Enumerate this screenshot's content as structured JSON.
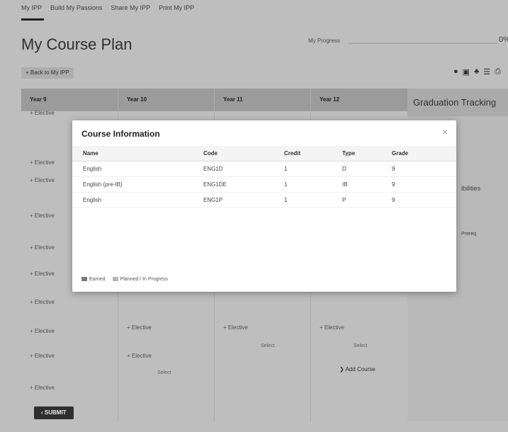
{
  "topnav": {
    "items": [
      "My IPP",
      "Build My Passions",
      "Share My IPP",
      "Print My IPP"
    ]
  },
  "page": {
    "title": "My Course Plan"
  },
  "progress": {
    "label": "My Progress",
    "percent": "0%"
  },
  "back_button": {
    "label": "Back to My IPP",
    "icon": "plus-icon"
  },
  "toolbar": {
    "icons": [
      "help-icon",
      "document-icon",
      "share-icon",
      "list-icon",
      "print-icon"
    ]
  },
  "years": [
    {
      "label": "Year 9"
    },
    {
      "label": "Year 10"
    },
    {
      "label": "Year 11"
    },
    {
      "label": "Year 12"
    }
  ],
  "year9_slots": [
    "+ Elective",
    "+ Elective",
    "+ Elective",
    "+ Elective",
    "+ Elective",
    "+ Elective",
    "+ Elective"
  ],
  "bottom_slots": {
    "y9": [
      "+ Elective",
      "+ Elective",
      "+ Elective"
    ],
    "y10": [
      "+ Elective",
      "+ Elective"
    ],
    "y11": [
      "+ Elective"
    ],
    "y12": [
      "+ Elective"
    ]
  },
  "course_selects": {
    "y10": "Select",
    "y11": "Select",
    "y12": "Select"
  },
  "add_course": {
    "label": "Add Course"
  },
  "graduation": {
    "title": "Graduation Tracking",
    "frag1": "ibilities",
    "frag2": "Prereq"
  },
  "submit": {
    "label": "SUBMIT"
  },
  "modal": {
    "title": "Course Information",
    "close": "×",
    "headers": {
      "name": "Name",
      "code": "Code",
      "credit": "Credit",
      "type": "Type",
      "grade": "Grade"
    },
    "rows": [
      {
        "name": "English",
        "code": "ENG1D",
        "credit": "1",
        "type": "D",
        "grade": "9"
      },
      {
        "name": "English (pre-IB)",
        "code": "ENG1DE",
        "credit": "1",
        "type": "IB",
        "grade": "9"
      },
      {
        "name": "English",
        "code": "ENG1P",
        "credit": "1",
        "type": "P",
        "grade": "9"
      }
    ],
    "legend": {
      "earned": "Earned",
      "planned": "Planned / In Progress"
    }
  },
  "colors": {
    "earned": "#7a7a7a",
    "planned": "#b5b5b5"
  }
}
